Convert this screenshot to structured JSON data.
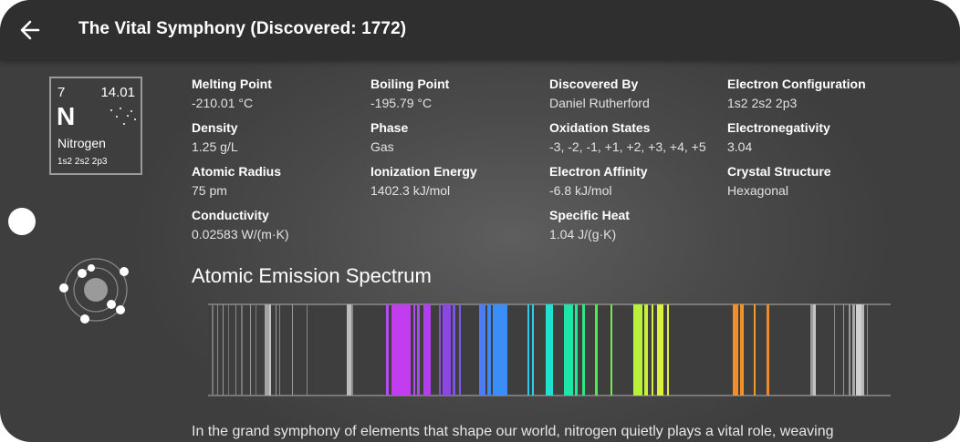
{
  "header": {
    "title": "The Vital Symphony (Discovered: 1772)",
    "back_icon": "arrow-left-icon"
  },
  "element": {
    "number": "7",
    "mass": "14.01",
    "symbol": "N",
    "name": "Nitrogen",
    "config_short": "1s2 2s2 2p3"
  },
  "properties": [
    {
      "label": "Melting Point",
      "value": "-210.01 °C"
    },
    {
      "label": "Boiling Point",
      "value": "-195.79 °C"
    },
    {
      "label": "Discovered By",
      "value": "Daniel Rutherford"
    },
    {
      "label": "Electron Configuration",
      "value": "1s2 2s2 2p3"
    },
    {
      "label": "Density",
      "value": "1.25 g/L"
    },
    {
      "label": "Phase",
      "value": "Gas"
    },
    {
      "label": "Oxidation States",
      "value": "-3, -2, -1, +1, +2, +3, +4, +5"
    },
    {
      "label": "Electronegativity",
      "value": "3.04"
    },
    {
      "label": "Atomic Radius",
      "value": "75 pm"
    },
    {
      "label": "Ionization Energy",
      "value": "1402.3 kJ/mol"
    },
    {
      "label": "Electron Affinity",
      "value": "-6.8 kJ/mol"
    },
    {
      "label": "Crystal Structure",
      "value": "Hexagonal"
    },
    {
      "label": "Conductivity",
      "value": "0.02583 W/(m·K)"
    },
    {
      "label": "Specific Heat",
      "value": "1.04 J/(g·K)"
    }
  ],
  "spectrum": {
    "title": "Atomic Emission Spectrum"
  },
  "description": "In the grand symphony of elements that shape our world, nitrogen quietly plays a vital role, weaving",
  "colors": {
    "background": "#4a4a4a",
    "topbar": "#2f2f2f"
  }
}
